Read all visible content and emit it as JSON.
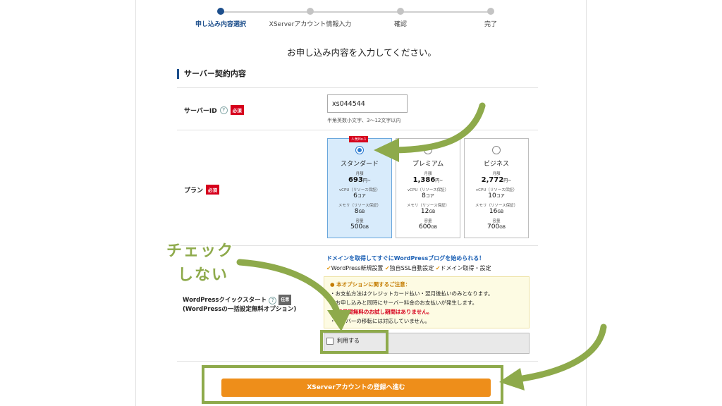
{
  "stepper": {
    "steps": [
      {
        "label": "申し込み内容選択",
        "active": true
      },
      {
        "label": "XServerアカウント情報入力",
        "active": false
      },
      {
        "label": "確認",
        "active": false
      },
      {
        "label": "完了",
        "active": false
      }
    ]
  },
  "lead_text": "お申し込み内容を入力してください。",
  "section_title": "サーバー契約内容",
  "server_id": {
    "label": "サーバーID",
    "required": "必須",
    "value": "xs044544",
    "hint": "半角英数小文字、3～12文字以内"
  },
  "plan": {
    "label": "プラン",
    "required": "必須",
    "badge": "人気No.1",
    "options": [
      {
        "name": "スタンダード",
        "monthly": "月額",
        "price": "693",
        "price_suffix": "円~",
        "vcpu_label": "vCPU（リソース保証）",
        "vcpu": "6",
        "vcpu_unit": "コア",
        "mem_label": "メモリ（リソース保証）",
        "mem": "8",
        "mem_unit": "GB",
        "disk_label": "容量",
        "disk": "500",
        "disk_unit": "GB",
        "selected": true
      },
      {
        "name": "プレミアム",
        "monthly": "月額",
        "price": "1,386",
        "price_suffix": "円~",
        "vcpu_label": "vCPU（リソース保証）",
        "vcpu": "8",
        "vcpu_unit": "コア",
        "mem_label": "メモリ（リソース保証）",
        "mem": "12",
        "mem_unit": "GB",
        "disk_label": "容量",
        "disk": "600",
        "disk_unit": "GB",
        "selected": false
      },
      {
        "name": "ビジネス",
        "monthly": "月額",
        "price": "2,772",
        "price_suffix": "円~",
        "vcpu_label": "vCPU（リソース保証）",
        "vcpu": "10",
        "vcpu_unit": "コア",
        "mem_label": "メモリ（リソース保証）",
        "mem": "16",
        "mem_unit": "GB",
        "disk_label": "容量",
        "disk": "700",
        "disk_unit": "GB",
        "selected": false
      }
    ]
  },
  "quickstart": {
    "label_line1": "WordPressクイックスタート",
    "tag": "任意",
    "label_line2": "(WordPressの一括設定無料オプション)",
    "promo": "ドメインを取得してすぐにWordPressブログを始められる！",
    "features": [
      "WordPress新規設置",
      "独自SSL自動設定",
      "ドメイン取得・設定"
    ],
    "notice_heading": "本オプションに関するご注意：",
    "notice_lines": [
      "お支払方法はクレジットカード払い・翌月後払いのみとなります。",
      "お申し込みと同時にサーバー料金のお支払いが発生します。",
      "10日間無料のお試し期間はありません。",
      "サーバーの移転には対応していません。"
    ],
    "use_label": "利用する",
    "use_checked": false
  },
  "submit_label": "XServerアカウントの登録へ進む",
  "annotation": {
    "line1": "チェック",
    "line2": "しない",
    "color": "#8eaa4b"
  },
  "colors": {
    "accent": "#1d4f8c",
    "required": "#d6001c",
    "submit": "#ee8e1a",
    "selected_plan": "#d8ebfb"
  }
}
